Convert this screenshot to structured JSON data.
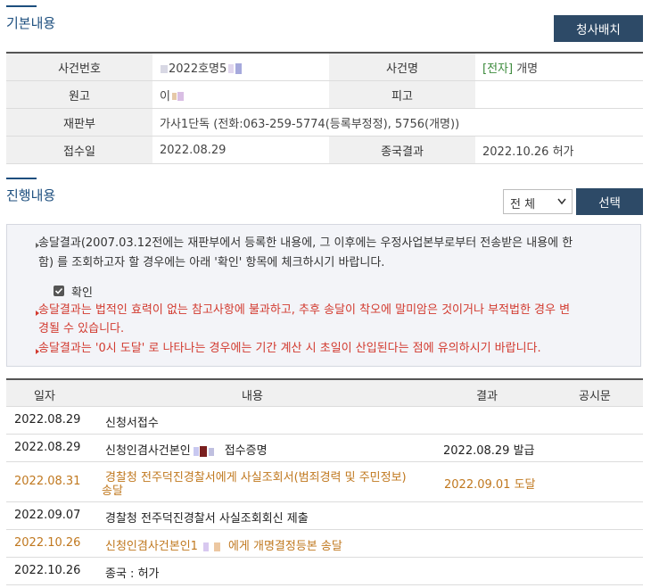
{
  "basic": {
    "title": "기본내용",
    "assign_button": "청사배치",
    "rows": [
      {
        "label1": "사건번호",
        "value1": "2022호명5",
        "label2": "사건명",
        "value2_prefix": "[전자]",
        "value2": "개명"
      },
      {
        "label1": "원고",
        "value1": "이",
        "label2": "피고",
        "value2_prefix": "",
        "value2": ""
      },
      {
        "label1": "재판부",
        "value1": "가사1단독 (전화:063-259-5774(등록부정정), 5756(개명))"
      },
      {
        "label1": "접수일",
        "value1": "2022.08.29",
        "label2": "종국결과",
        "value2_prefix": "",
        "value2": "2022.10.26 허가"
      }
    ]
  },
  "progress": {
    "title": "진행내용",
    "filter_value": "전 체",
    "select_button": "선택",
    "notice": {
      "line1": "송달결과(2007.03.12전에는 재판부에서 등록한 내용에, 그 이후에는 우정사업본부로부터 전송받은 내용에 한",
      "line2": "함) 를 조회하고자 할 경우에는 아래 '확인' 항목에 체크하시기 바랍니다.",
      "checkbox_label": "확인",
      "line3": "송달결과는 법적인 효력이 없는 참고사항에 불과하고, 추후 송달이 착오에 말미암은 것이거나 부적법한 경우 변",
      "line4": "경될 수 있습니다.",
      "line5": "송달결과는 '0시 도달' 로 나타나는 경우에는 기간 계산 시 초일이 산입된다는 점에 유의하시기 바랍니다."
    },
    "columns": {
      "date": "일자",
      "content": "내용",
      "result": "결과",
      "public": "공시문"
    },
    "rows": [
      {
        "date": "2022.08.29",
        "content": "신청서접수",
        "content2": "",
        "result": ""
      },
      {
        "date": "2022.08.29",
        "content": "신청인겸사건본인",
        "content_suffix": "접수증명",
        "result": "2022.08.29 발급"
      },
      {
        "date": "2022.08.31",
        "content": "경찰청 전주덕진경찰서에게 사실조회서(범죄경력 및 주민정보)",
        "content2": "송달",
        "result": "2022.09.01 도달"
      },
      {
        "date": "2022.09.07",
        "content": "경찰청 전주덕진경찰서 사실조회회신 제출",
        "content2": "",
        "result": ""
      },
      {
        "date": "2022.10.26",
        "content": "신청인겸사건본인1",
        "content_suffix": "에게 개명결정등본 송달",
        "result": ""
      },
      {
        "date": "2022.10.26",
        "content": "종국 : 허가",
        "content2": "",
        "result": ""
      }
    ]
  }
}
